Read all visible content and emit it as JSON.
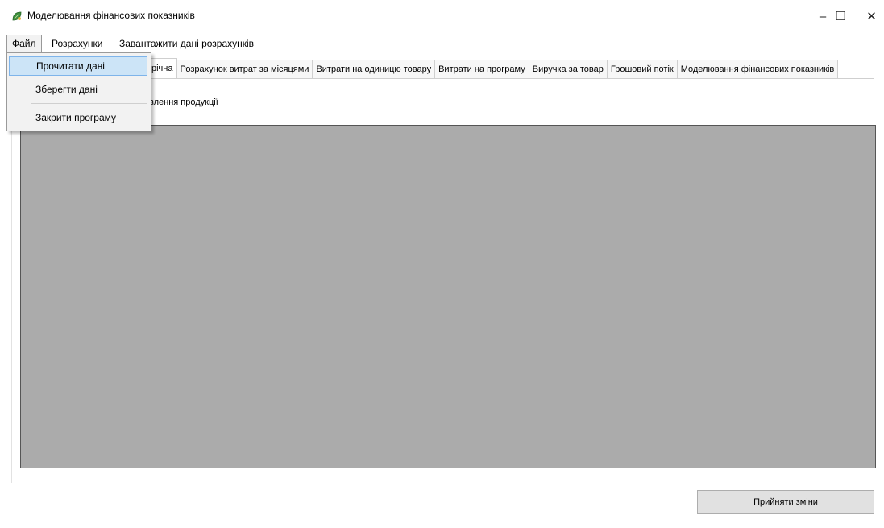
{
  "window": {
    "title": "Моделювання фінансових показників",
    "icon": "app-leaf-icon",
    "controls": {
      "minimize": "–",
      "maximize": "☐",
      "close": "✕"
    }
  },
  "menubar": {
    "items": [
      "Файл",
      "Розрахунки",
      "Завантажити дані розрахунків"
    ]
  },
  "file_menu": {
    "items": [
      "Прочитати дані",
      "Зберегти дані",
      "Закрити програму"
    ],
    "highlighted": "Прочитати дані"
  },
  "tabs": [
    "річна",
    "Розрахунок витрат за місяцями",
    "Витрати на одиницю товару",
    "Витрати на програму",
    "Виручка за товар",
    "Грошовий потік",
    "Моделювання фінансових показників"
  ],
  "content": {
    "section_label": "влення продукції",
    "grid_color": "#ababab"
  },
  "buttons": {
    "accept": "Прийняти зміни"
  }
}
